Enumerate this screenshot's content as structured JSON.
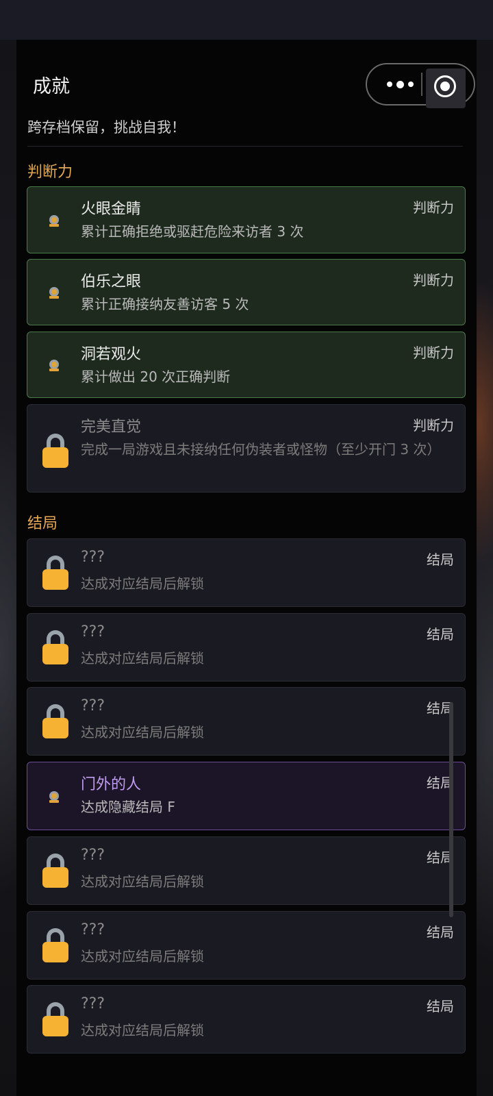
{
  "page": {
    "title": "成就",
    "subtitle": "跨存档保留，挑战自我！"
  },
  "capsule": {
    "more_icon": "more-dots-icon",
    "close_icon": "target-circle-icon"
  },
  "sections": [
    {
      "title": "判断力",
      "items": [
        {
          "name": "火眼金睛",
          "category": "判断力",
          "desc": "累计正确拒绝或驱赶危险来访者 3 次",
          "state": "unlocked",
          "icon": "trophy-icon"
        },
        {
          "name": "伯乐之眼",
          "category": "判断力",
          "desc": "累计正确接纳友善访客 5 次",
          "state": "unlocked",
          "icon": "trophy-icon"
        },
        {
          "name": "洞若观火",
          "category": "判断力",
          "desc": "累计做出 20 次正确判断",
          "state": "unlocked",
          "icon": "trophy-icon"
        },
        {
          "name": "完美直觉",
          "category": "判断力",
          "desc": "完成一局游戏且未接纳任何伪装者或怪物（至少开门 3 次）",
          "state": "locked",
          "icon": "lock-icon"
        }
      ]
    },
    {
      "title": "结局",
      "items": [
        {
          "name": "???",
          "category": "结局",
          "desc": "达成对应结局后解锁",
          "state": "locked",
          "icon": "lock-icon"
        },
        {
          "name": "???",
          "category": "结局",
          "desc": "达成对应结局后解锁",
          "state": "locked",
          "icon": "lock-icon"
        },
        {
          "name": "???",
          "category": "结局",
          "desc": "达成对应结局后解锁",
          "state": "locked",
          "icon": "lock-icon"
        },
        {
          "name": "门外的人",
          "category": "结局",
          "desc": "达成隐藏结局 F",
          "state": "hidden-unlocked",
          "icon": "trophy-icon"
        },
        {
          "name": "???",
          "category": "结局",
          "desc": "达成对应结局后解锁",
          "state": "locked",
          "icon": "lock-icon"
        },
        {
          "name": "???",
          "category": "结局",
          "desc": "达成对应结局后解锁",
          "state": "locked",
          "icon": "lock-icon"
        },
        {
          "name": "???",
          "category": "结局",
          "desc": "达成对应结局后解锁",
          "state": "locked",
          "icon": "lock-icon"
        }
      ]
    }
  ],
  "colors": {
    "section_title": "#e3a652",
    "unlocked_bg": "#1f2a1f",
    "unlocked_border": "#4a7c49",
    "hidden_border": "#6b4f94",
    "hidden_name": "#c09cf0",
    "lock_body": "#f6b233"
  }
}
